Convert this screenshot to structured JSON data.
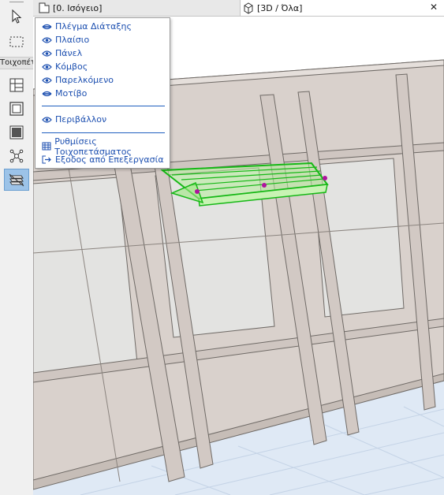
{
  "toolbox": {
    "section_label": "Τοιχοπέτασμα",
    "tools": [
      {
        "icon": "arrow-icon"
      },
      {
        "icon": "marquee-icon"
      },
      {
        "icon": "curtain-wall-grid-icon"
      },
      {
        "icon": "frame-icon"
      },
      {
        "icon": "panel-icon"
      },
      {
        "icon": "junction-icon"
      },
      {
        "icon": "accessory-icon",
        "active": true
      }
    ]
  },
  "tabs": {
    "plan": {
      "label": "[0. Ισόγειο]",
      "icon": "plan-icon"
    },
    "threed": {
      "label": "[3D / Όλα]",
      "icon": "3d-cube-icon",
      "close": "✕"
    }
  },
  "context_menu": {
    "items": [
      {
        "label": "Πλέγμα Διάταξης",
        "icon": "eye-closed-icon"
      },
      {
        "label": "Πλαίσιο",
        "icon": "eye-icon"
      },
      {
        "label": "Πάνελ",
        "icon": "eye-icon"
      },
      {
        "label": "Κόμβος",
        "icon": "eye-icon"
      },
      {
        "label": "Παρελκόμενο",
        "icon": "eye-icon"
      },
      {
        "label": "Μοτίβο",
        "icon": "eye-closed-icon"
      }
    ],
    "boundary_item": {
      "label": "Περιβάλλον",
      "icon": "eye-icon"
    },
    "actions": [
      {
        "label": "Ρυθμίσεις Τοιχοπετάσματος",
        "icon": "settings-grid-icon"
      },
      {
        "label": "Εξοδος από Επεξεργασία",
        "icon": "exit-icon"
      }
    ]
  },
  "colors": {
    "menu_text": "#1c4fb0",
    "selection_green": "#17c317",
    "wall": "#d9d1cc",
    "glass": "#e3e3e1",
    "ground": "#dfe9f5"
  }
}
